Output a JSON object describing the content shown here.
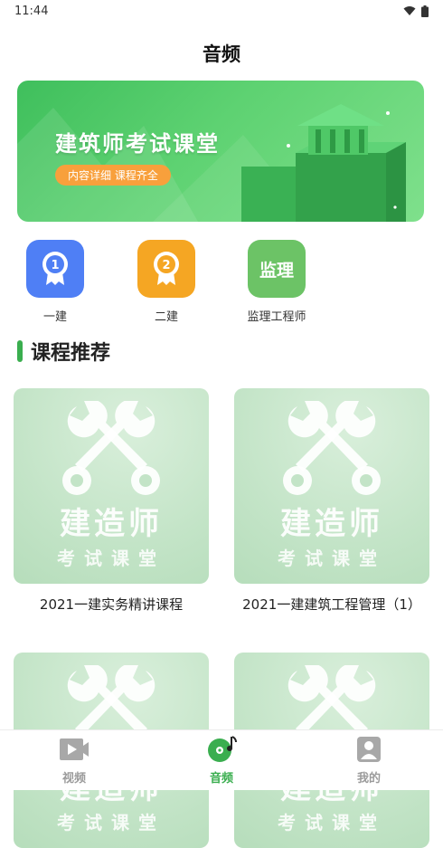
{
  "status_bar": {
    "time": "11:44"
  },
  "header": {
    "title": "音频"
  },
  "banner": {
    "title": "建筑师考试课堂",
    "pill": "内容详细 课程齐全"
  },
  "categories": [
    {
      "label": "一建",
      "badge": "1",
      "color": "#4f7ff5"
    },
    {
      "label": "二建",
      "badge": "2",
      "color": "#f5a623"
    },
    {
      "label": "监理工程师",
      "badge": "监理",
      "color": "#6cc366"
    }
  ],
  "section": {
    "title": "课程推荐"
  },
  "courses": [
    {
      "thumb_main": "建造师",
      "thumb_sub": "考试课堂",
      "title": "2021一建实务精讲课程"
    },
    {
      "thumb_main": "建造师",
      "thumb_sub": "考试课堂",
      "title": "2021一建建筑工程管理（1）"
    },
    {
      "thumb_main": "建造师",
      "thumb_sub": "考试课堂",
      "title": ""
    },
    {
      "thumb_main": "建造师",
      "thumb_sub": "考试课堂",
      "title": ""
    }
  ],
  "tab_bar": {
    "tabs": [
      {
        "label": "视频",
        "icon": "video-icon",
        "active": false
      },
      {
        "label": "音频",
        "icon": "music-disc-icon",
        "active": true
      },
      {
        "label": "我的",
        "icon": "user-icon",
        "active": false
      }
    ]
  },
  "colors": {
    "accent": "#3aae4f",
    "inactive": "#9b9b9b"
  }
}
